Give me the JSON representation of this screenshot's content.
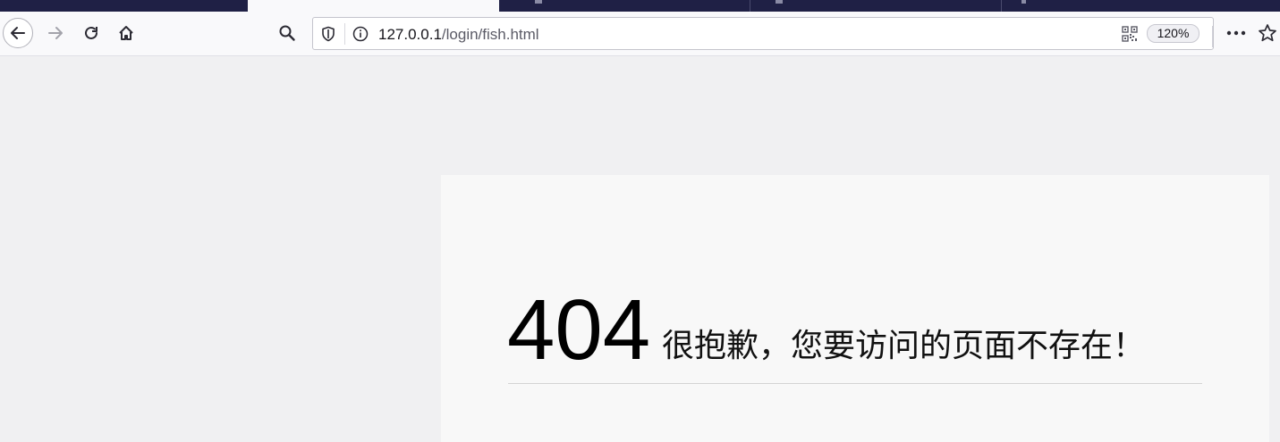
{
  "browser": {
    "url_host": "127.0.0.1",
    "url_path": "/login/fish.html",
    "zoom": "120%"
  },
  "page": {
    "error_code": "404",
    "error_message": "很抱歉，您要访问的页面不存在！"
  },
  "colors": {
    "tabstrip": "#1f2045",
    "toolbar": "#f9f9fb",
    "page_bg": "#f0f0f2",
    "card_bg": "#f8f8f8"
  }
}
